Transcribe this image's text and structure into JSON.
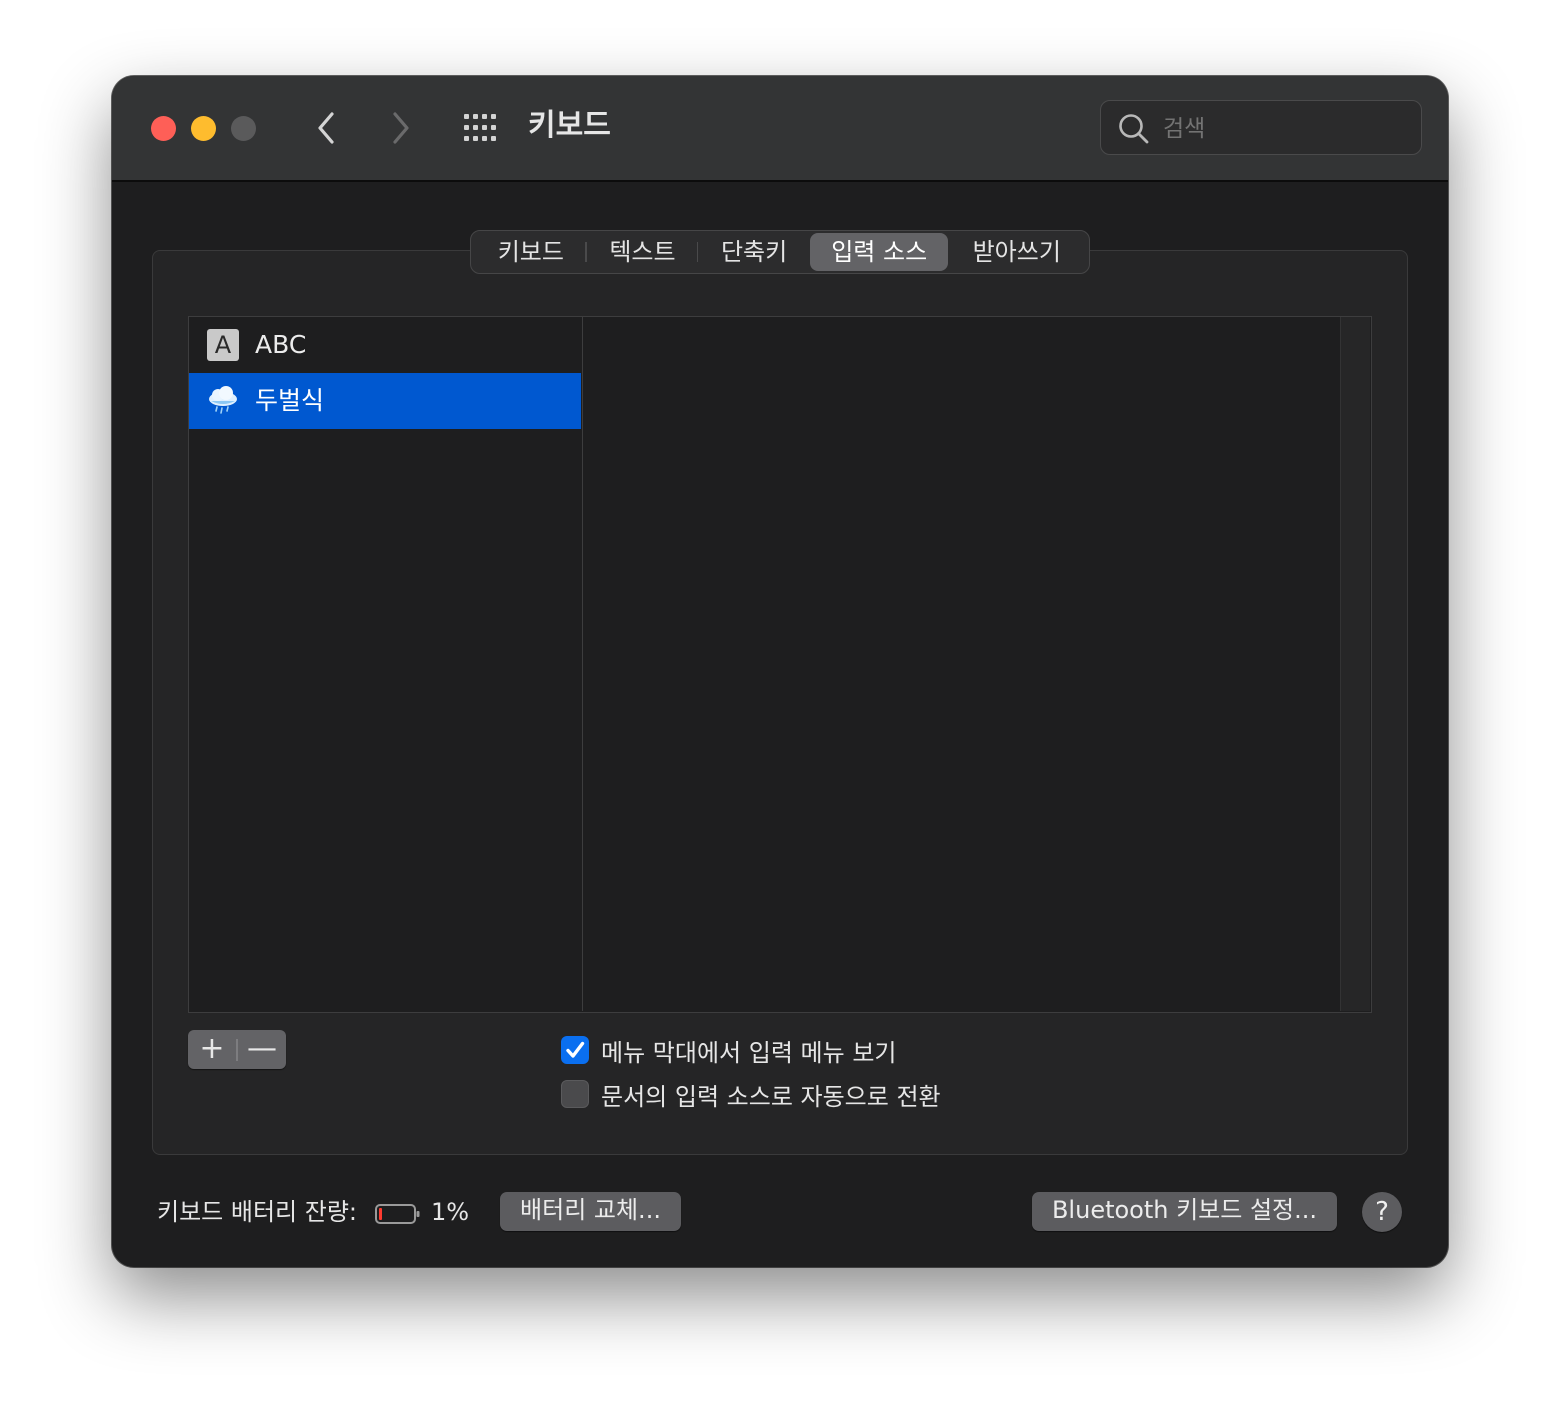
{
  "window": {
    "title": "키보드",
    "traffic_lights": {
      "close": "#fe5f57",
      "minimize": "#febc2e",
      "zoom": "#5a5a5b"
    },
    "nav": {
      "back_icon": "chevron-left-icon",
      "forward_icon": "chevron-right-icon",
      "grid_icon": "show-all-grid-icon"
    },
    "search": {
      "placeholder": "검색",
      "value": ""
    }
  },
  "tabs": [
    {
      "label": "키보드",
      "active": false
    },
    {
      "label": "텍스트",
      "active": false
    },
    {
      "label": "단축키",
      "active": false
    },
    {
      "label": "입력 소스",
      "active": true
    },
    {
      "label": "받아쓰기",
      "active": false
    }
  ],
  "input_sources": [
    {
      "label": "ABC",
      "icon": "letter-a-badge-icon",
      "icon_letter": "A",
      "selected": false
    },
    {
      "label": "두벌식",
      "icon": "cloud-rain-icon",
      "selected": true
    }
  ],
  "list_controls": {
    "add": "+",
    "remove": "—"
  },
  "options": {
    "show_menu": {
      "label": "메뉴 막대에서 입력 메뉴 보기",
      "checked": true
    },
    "auto_switch": {
      "label": "문서의 입력 소스로 자동으로 전환",
      "checked": false
    }
  },
  "footer": {
    "battery_label": "키보드 배터리 잔량:",
    "battery_percent": "1%",
    "battery_level": 0.01,
    "replace_button": "배터리 교체...",
    "bluetooth_button": "Bluetooth 키보드 설정...",
    "help_button": "?"
  },
  "colors": {
    "accent": "#0a6ff0",
    "selection": "#0058d0",
    "battery_low": "#ff3b30"
  }
}
